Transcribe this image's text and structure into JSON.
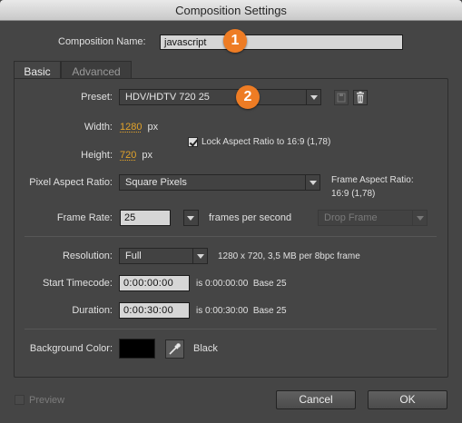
{
  "window": {
    "title": "Composition Settings"
  },
  "comp_name": {
    "label": "Composition Name:",
    "value": "javascript"
  },
  "tabs": [
    {
      "label": "Basic"
    },
    {
      "label": "Advanced"
    }
  ],
  "preset": {
    "label": "Preset:",
    "value": "HDV/HDTV 720 25"
  },
  "width": {
    "label": "Width:",
    "value": "1280",
    "unit": "px"
  },
  "height": {
    "label": "Height:",
    "value": "720",
    "unit": "px"
  },
  "lock_aspect": {
    "label": "Lock Aspect Ratio to 16:9 (1,78)",
    "checked": true
  },
  "pixel_aspect": {
    "label": "Pixel Aspect Ratio:",
    "value": "Square Pixels",
    "frame_aspect_label": "Frame Aspect Ratio:",
    "frame_aspect_value": "16:9 (1,78)"
  },
  "frame_rate": {
    "label": "Frame Rate:",
    "value": "25",
    "unit": "frames per second",
    "drop_frame": "Drop Frame"
  },
  "resolution": {
    "label": "Resolution:",
    "value": "Full",
    "info": "1280 x 720, 3,5 MB per 8bpc frame"
  },
  "start_timecode": {
    "label": "Start Timecode:",
    "value": "0:00:00:00",
    "info": "is 0:00:00:00  Base 25"
  },
  "duration": {
    "label": "Duration:",
    "value": "0:00:30:00",
    "info": "is 0:00:30:00  Base 25"
  },
  "background": {
    "label": "Background Color:",
    "color_name": "Black",
    "swatch_color": "#000000"
  },
  "preview": {
    "label": "Preview",
    "checked": false
  },
  "buttons": {
    "cancel": "Cancel",
    "ok": "OK"
  },
  "annotations": [
    {
      "number": "1"
    },
    {
      "number": "2"
    }
  ],
  "colors": {
    "accent": "#e2a32a",
    "badge": "#ee7c24",
    "panel": "#454545"
  }
}
